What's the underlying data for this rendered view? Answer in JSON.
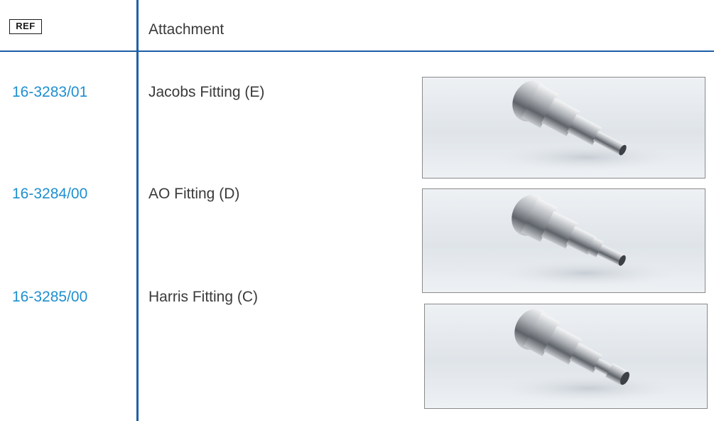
{
  "header": {
    "ref_symbol": "REF",
    "attachment_label": "Attachment"
  },
  "rows": [
    {
      "ref": "16-3283/01",
      "name": "Jacobs Fitting (E)",
      "image_icon": "jacobs-fitting-photo"
    },
    {
      "ref": "16-3284/00",
      "name": "AO Fitting (D)",
      "image_icon": "ao-fitting-photo"
    },
    {
      "ref": "16-3285/00",
      "name": "Harris Fitting (C)",
      "image_icon": "harris-fitting-photo"
    }
  ],
  "colors": {
    "rule_blue": "#1e5fa8",
    "ref_text_blue": "#1e8fd0",
    "text_gray": "#3a3a3a"
  }
}
